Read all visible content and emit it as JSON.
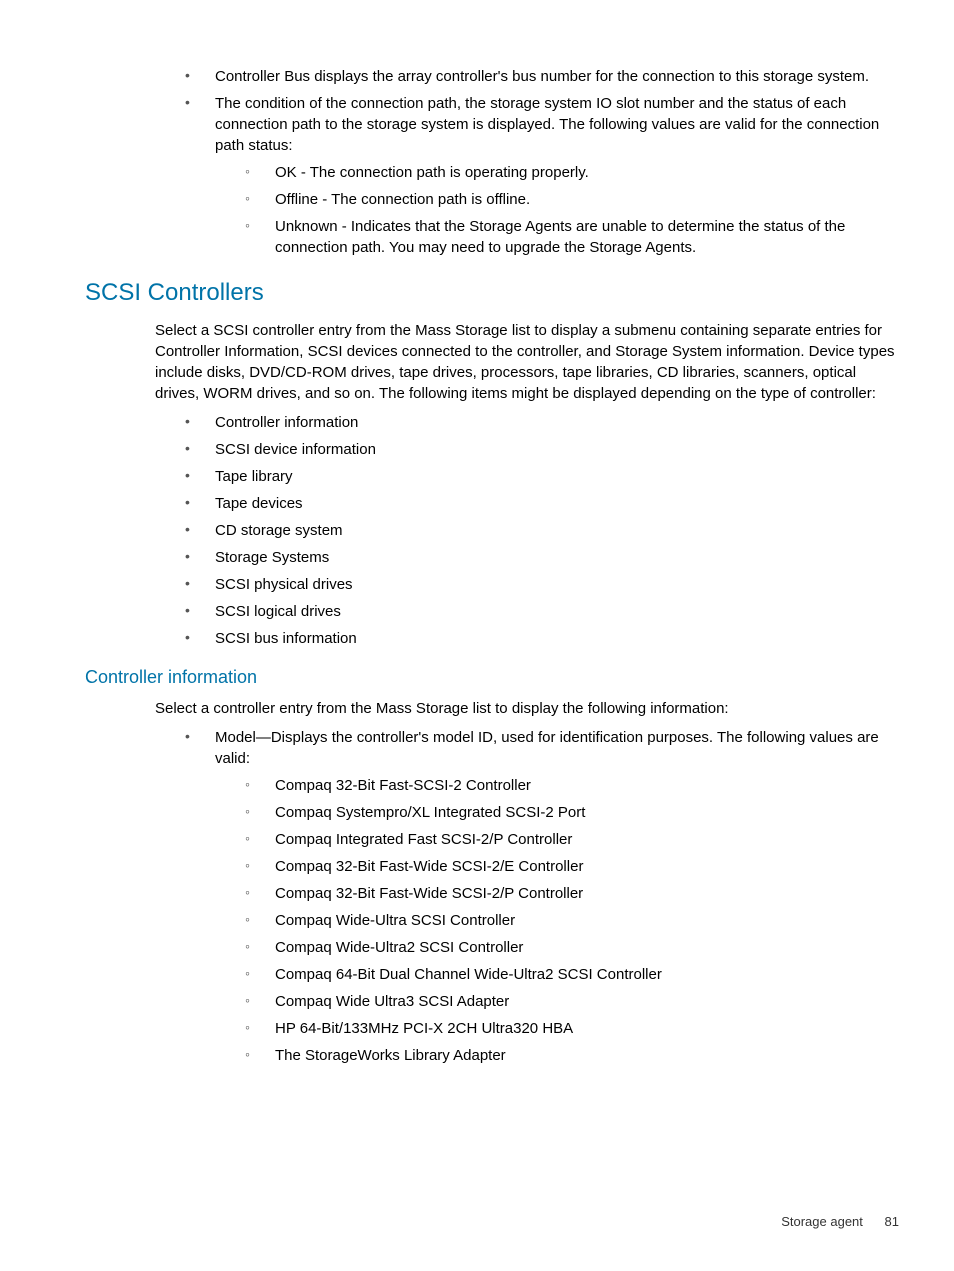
{
  "intro_bullets": [
    {
      "text": "Controller Bus displays the array controller's bus number for the connection to this storage system."
    },
    {
      "text": "The condition of the connection path, the storage system IO slot number and the status of each connection path to the storage system is displayed. The following values are valid for the connection path status:",
      "sub": [
        "OK - The connection path is operating properly.",
        "Offline - The connection path is offline.",
        "Unknown - Indicates that the Storage Agents are unable to determine the status of the connection path. You may need to upgrade the Storage Agents."
      ]
    }
  ],
  "scsi": {
    "heading": "SCSI Controllers",
    "intro": "Select a SCSI controller entry from the Mass Storage list to display a submenu containing separate entries for Controller Information, SCSI devices connected to the controller, and Storage System information. Device types include disks, DVD/CD-ROM drives, tape drives, processors, tape libraries, CD libraries, scanners, optical drives, WORM drives, and so on. The following items might be displayed depending on the type of controller:",
    "items": [
      "Controller information",
      "SCSI device information",
      "Tape library",
      "Tape devices",
      "CD storage system",
      "Storage Systems",
      "SCSI physical drives",
      "SCSI logical drives",
      "SCSI bus information"
    ]
  },
  "controller_info": {
    "heading": "Controller information",
    "intro": "Select a controller entry from the Mass Storage list to display the following information:",
    "model": {
      "text": "Model—Displays the controller's model ID, used for identification purposes. The following values are valid:",
      "values": [
        "Compaq 32-Bit Fast-SCSI-2 Controller",
        "Compaq Systempro/XL Integrated SCSI-2 Port",
        "Compaq Integrated Fast SCSI-2/P Controller",
        "Compaq 32-Bit Fast-Wide SCSI-2/E Controller",
        "Compaq 32-Bit Fast-Wide SCSI-2/P Controller",
        "Compaq Wide-Ultra SCSI Controller",
        "Compaq Wide-Ultra2 SCSI Controller",
        "Compaq 64-Bit Dual Channel Wide-Ultra2 SCSI Controller",
        "Compaq Wide Ultra3 SCSI Adapter",
        "HP 64-Bit/133MHz PCI-X 2CH Ultra320 HBA",
        "The StorageWorks Library Adapter"
      ]
    }
  },
  "footer": {
    "section": "Storage agent",
    "page": "81"
  }
}
